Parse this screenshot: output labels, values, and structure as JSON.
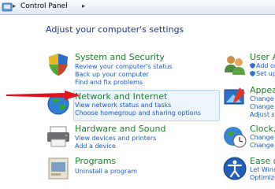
{
  "address_bar": {
    "breadcrumb": "Control Panel",
    "separator": "▸"
  },
  "page": {
    "title": "Adjust your computer's settings"
  },
  "categories": [
    {
      "heading": "System and Security",
      "links": [
        "Review your computer's status",
        "Back up your computer",
        "Find and fix problems"
      ]
    },
    {
      "heading": "Network and Internet",
      "links": [
        "View network status and tasks",
        "Choose homegroup and sharing options"
      ]
    },
    {
      "heading": "Hardware and Sound",
      "links": [
        "View devices and printers",
        "Add a device"
      ]
    },
    {
      "heading": "Programs",
      "links": [
        "Uninstall a program"
      ]
    }
  ],
  "right_categories": [
    {
      "heading": "User Ac",
      "links": [
        "Add or",
        "Set up"
      ]
    },
    {
      "heading": "Appear",
      "links": [
        "Change th",
        "Change d",
        "Adjust sc"
      ]
    },
    {
      "heading": "Clock, L",
      "links": [
        "Change k",
        "Change d"
      ]
    },
    {
      "heading": "Ease of",
      "links": [
        "Let Wind",
        "Optimize"
      ]
    }
  ],
  "annotation": {
    "arrow_color": "#e0141e"
  }
}
